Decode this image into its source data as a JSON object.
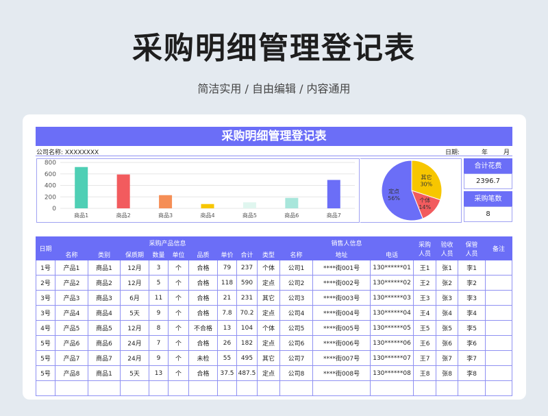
{
  "page": {
    "title": "采购明细管理登记表",
    "subtitle": "简洁实用 / 自由编辑 / 内容通用"
  },
  "sheet": {
    "banner": "采购明细管理登记表",
    "company_label": "公司名称:  XXXXXXXX",
    "date_label": "日期:",
    "year_label": "年",
    "month_label": "月"
  },
  "kpis": {
    "total_cost_label": "合计花费",
    "total_cost_value": "2396.7",
    "purchase_count_label": "采购笔数",
    "purchase_count_value": "8"
  },
  "chart_data": [
    {
      "type": "bar",
      "categories": [
        "商品1",
        "商品2",
        "商品3",
        "商品4",
        "商品5",
        "商品6",
        "商品7"
      ],
      "values": [
        720,
        590,
        230,
        75,
        105,
        182,
        495
      ],
      "ylim": [
        0,
        800
      ],
      "yticks": [
        0,
        200,
        400,
        600,
        800
      ],
      "colors": [
        "#4fcfb5",
        "#f25b5e",
        "#f58e56",
        "#f7c600",
        "#e0f6ef",
        "#a8e6db",
        "#6b6ef7"
      ],
      "grid": true
    },
    {
      "type": "pie",
      "slices": [
        {
          "label": "其它",
          "percent": 30,
          "value_label": "30%",
          "color": "#f7c600"
        },
        {
          "label": "个体",
          "percent": 14,
          "value_label": "14%",
          "color": "#f25b5e"
        },
        {
          "label": "定点",
          "percent": 56,
          "value_label": "56%",
          "color": "#6b6ef7"
        }
      ]
    }
  ],
  "table": {
    "group_headers": {
      "date": "日期",
      "product_info": "采购产品信息",
      "seller_info": "销售人信息",
      "purchaser": "采购人员",
      "inspector": "验收人员",
      "keeper": "保管人员",
      "remark": "备注"
    },
    "sub_headers": {
      "name": "名称",
      "category": "类别",
      "shelf_life": "保质期",
      "qty": "数量",
      "unit": "单位",
      "quality": "品质",
      "price": "单价",
      "total": "合计",
      "type": "类型",
      "seller_name": "名称",
      "address": "地址",
      "phone": "电话"
    },
    "rows": [
      [
        "1号",
        "产品1",
        "商品1",
        "12月",
        "3",
        "个",
        "合格",
        "79",
        "237",
        "个体",
        "公司1",
        "****街001号",
        "130******01",
        "王1",
        "张1",
        "李1",
        ""
      ],
      [
        "2号",
        "产品2",
        "商品2",
        "12月",
        "5",
        "个",
        "合格",
        "118",
        "590",
        "定点",
        "公司2",
        "****街002号",
        "130******02",
        "王2",
        "张2",
        "李2",
        ""
      ],
      [
        "3号",
        "产品3",
        "商品3",
        "6月",
        "11",
        "个",
        "合格",
        "21",
        "231",
        "其它",
        "公司3",
        "****街003号",
        "130******03",
        "王3",
        "张3",
        "李3",
        ""
      ],
      [
        "3号",
        "产品4",
        "商品4",
        "5天",
        "9",
        "个",
        "合格",
        "7.8",
        "70.2",
        "定点",
        "公司4",
        "****街004号",
        "130******04",
        "王4",
        "张4",
        "李4",
        ""
      ],
      [
        "4号",
        "产品5",
        "商品5",
        "12月",
        "8",
        "个",
        "不合格",
        "13",
        "104",
        "个体",
        "公司5",
        "****街005号",
        "130******05",
        "王5",
        "张5",
        "李5",
        ""
      ],
      [
        "5号",
        "产品6",
        "商品6",
        "24月",
        "7",
        "个",
        "合格",
        "26",
        "182",
        "定点",
        "公司6",
        "****街006号",
        "130******06",
        "王6",
        "张6",
        "李6",
        ""
      ],
      [
        "5号",
        "产品7",
        "商品7",
        "24月",
        "9",
        "个",
        "未检",
        "55",
        "495",
        "其它",
        "公司7",
        "****街007号",
        "130******07",
        "王7",
        "张7",
        "李7",
        ""
      ],
      [
        "5号",
        "产品8",
        "商品1",
        "5天",
        "13",
        "个",
        "合格",
        "37.5",
        "487.5",
        "定点",
        "公司8",
        "****街008号",
        "130******08",
        "王8",
        "张8",
        "李8",
        ""
      ],
      [
        "",
        "",
        "",
        "",
        "",
        "",
        "",
        "",
        "",
        "",
        "",
        "",
        "",
        "",
        "",
        "",
        ""
      ]
    ]
  }
}
